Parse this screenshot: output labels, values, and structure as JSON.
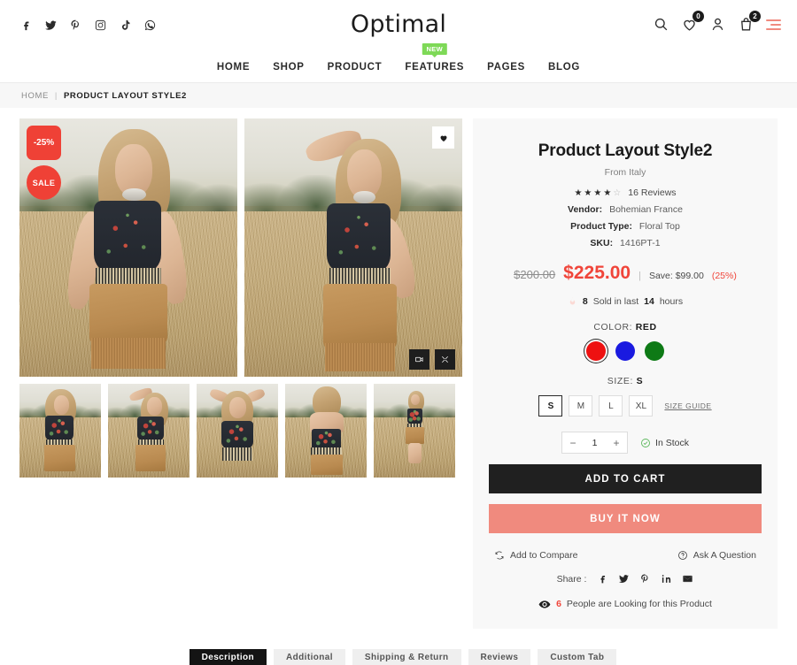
{
  "header": {
    "logo": "Optimal",
    "socials": [
      {
        "name": "facebook-icon",
        "label": "Facebook"
      },
      {
        "name": "twitter-icon",
        "label": "Twitter"
      },
      {
        "name": "pinterest-icon",
        "label": "Pinterest"
      },
      {
        "name": "instagram-icon",
        "label": "Instagram"
      },
      {
        "name": "tiktok-icon",
        "label": "TikTok"
      },
      {
        "name": "whatsapp-icon",
        "label": "WhatsApp"
      }
    ],
    "utils": {
      "search": "search-icon",
      "wishlist": "heart-icon",
      "wishlist_count": "0",
      "account": "user-icon",
      "cart": "bag-icon",
      "cart_count": "2",
      "menu": "hamburger-icon",
      "menu_color": "#f08a7e"
    }
  },
  "nav": {
    "items": [
      {
        "label": "HOME"
      },
      {
        "label": "SHOP"
      },
      {
        "label": "PRODUCT"
      },
      {
        "label": "FEATURES",
        "badge": "NEW",
        "badge_color": "#7ed957"
      },
      {
        "label": "PAGES"
      },
      {
        "label": "BLOG"
      }
    ]
  },
  "breadcrumb": {
    "home": "HOME",
    "separator": "|",
    "current": "PRODUCT LAYOUT STYLE2"
  },
  "gallery": {
    "discount_badge": "-25%",
    "sale_badge": "SALE",
    "badge_color": "#ef4136",
    "wishlist_icon": "heart-icon",
    "video_icon": "video-camera-icon",
    "fullscreen_icon": "expand-icon",
    "main_images": [
      {
        "alt": "Model in floral top seated in dry grass field"
      },
      {
        "alt": "Model in floral top standing with hand shading eyes"
      }
    ],
    "thumbnails": [
      {
        "alt": "Model seated in field"
      },
      {
        "alt": "Model standing hand to brow"
      },
      {
        "alt": "Model with arms raised"
      },
      {
        "alt": "Back view of floral top"
      },
      {
        "alt": "Full body shot in field"
      }
    ]
  },
  "product": {
    "title": "Product Layout Style2",
    "origin": "From Italy",
    "rating": 4,
    "rating_max": 5,
    "reviews": "16 Reviews",
    "meta": [
      {
        "key": "Vendor:",
        "value": "Bohemian France"
      },
      {
        "key": "Product Type:",
        "value": "Floral Top"
      },
      {
        "key": "SKU:",
        "value": "1416PT-1"
      }
    ],
    "price": {
      "old": "$200.00",
      "current": "$225.00",
      "pipe": "|",
      "save_label": "Save: $99.00",
      "save_pct": "(25%)",
      "accent": "#f0453a"
    },
    "sold": {
      "icon": "flame-icon",
      "count": "8",
      "mid": "Sold in last",
      "hours": "14",
      "suffix": "hours"
    },
    "color": {
      "label": "COLOR:",
      "selected": "RED",
      "options": [
        {
          "name": "Red",
          "hex": "#ee1111",
          "selected": true
        },
        {
          "name": "Blue",
          "hex": "#1a1ae0",
          "selected": false
        },
        {
          "name": "Green",
          "hex": "#0e7a16",
          "selected": false
        }
      ]
    },
    "size": {
      "label": "SIZE:",
      "selected": "S",
      "options": [
        {
          "label": "S",
          "selected": true
        },
        {
          "label": "M",
          "selected": false
        },
        {
          "label": "L",
          "selected": false
        },
        {
          "label": "XL",
          "selected": false
        }
      ],
      "guide_link": "SIZE GUIDE"
    },
    "quantity": {
      "minus": "−",
      "value": "1",
      "plus": "+"
    },
    "stock": {
      "icon": "check-circle-icon",
      "label": "In Stock",
      "color": "#5cb85c"
    },
    "add_to_cart": "ADD TO CART",
    "buy_now": "BUY IT NOW",
    "compare": {
      "icon": "compare-icon",
      "label": "Add to Compare"
    },
    "ask": {
      "icon": "question-circle-icon",
      "label": "Ask A Question"
    },
    "share": {
      "label": "Share :",
      "icons": [
        {
          "name": "facebook-icon"
        },
        {
          "name": "twitter-icon"
        },
        {
          "name": "pinterest-icon"
        },
        {
          "name": "linkedin-icon"
        },
        {
          "name": "email-icon"
        }
      ]
    },
    "looking": {
      "icon": "eye-icon",
      "count": "6",
      "text": "People are Looking for this Product"
    }
  },
  "tabs": [
    {
      "label": "Description",
      "selected": true
    },
    {
      "label": "Additional",
      "selected": false
    },
    {
      "label": "Shipping & Return",
      "selected": false
    },
    {
      "label": "Reviews",
      "selected": false
    },
    {
      "label": "Custom Tab",
      "selected": false
    }
  ]
}
